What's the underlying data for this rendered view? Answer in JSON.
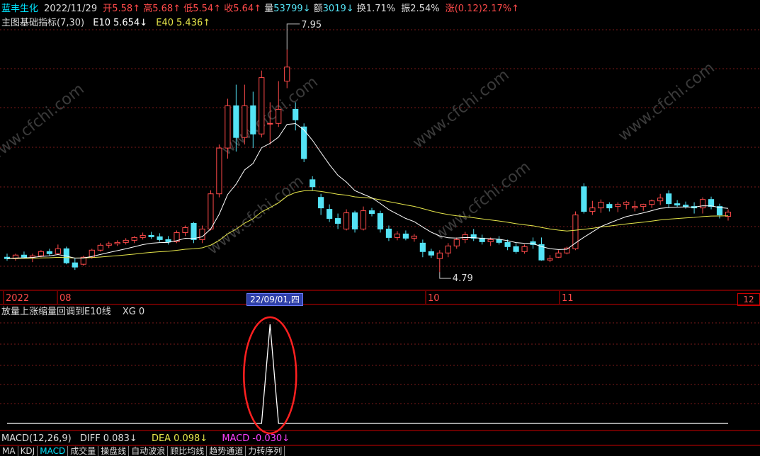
{
  "header": {
    "stock_name": "蓝丰生化",
    "date": "2022/11/29",
    "open_label": "开",
    "open_value": "5.58↑",
    "high_label": "高",
    "high_value": "5.68↑",
    "low_label": "低",
    "low_value": "5.54↑",
    "close_label": "收",
    "close_value": "5.64↑",
    "volume_label": "量",
    "volume_value": "53799↓",
    "amount_label": "额",
    "amount_value": "3019↓",
    "turnover_label": "换",
    "turnover_value": "1.71%",
    "amplitude_label": "振",
    "amplitude_value": "2.54%",
    "change_label": "涨",
    "change_value": "(0.12)2.17%↑"
  },
  "indicator": {
    "name": "主图基础指标(7,30)",
    "e10_label": "E10",
    "e10_value": "5.654↓",
    "e40_label": "E40",
    "e40_value": "5.436↑"
  },
  "annotations": {
    "high_mark": "7.95",
    "low_mark": "4.79"
  },
  "x_axis": {
    "labels": [
      "2022",
      "08",
      "10",
      "11"
    ],
    "cursor_date": "22/09/01,四",
    "right_label": "12"
  },
  "xg_panel": {
    "title": "放量上涨缩量回调到E10线",
    "xg_label": "XG",
    "xg_value": "0"
  },
  "macd_panel": {
    "name": "MACD(12,26,9)",
    "diff_label": "DIFF",
    "diff_value": "0.083↓",
    "dea_label": "DEA",
    "dea_value": "0.098↓",
    "macd_label": "MACD",
    "macd_value": "-0.030↓"
  },
  "tabs": [
    "MA",
    "KDJ",
    "MACD",
    "成交量",
    "操盘线",
    "自动波浪",
    "顾比均线",
    "趋势通道",
    "力转序列"
  ],
  "active_tab": "MACD",
  "watermark": "www.cfchi.com",
  "colors": {
    "up": "#ff4a4a",
    "down": "#54e3f5",
    "e10": "#ffffff",
    "e40": "#e6e64a",
    "grid": "#7a1a1a",
    "highlight_circle": "#ff2020"
  },
  "chart_data": {
    "type": "candlestick",
    "candles": [
      [
        5.0,
        5.05,
        4.95,
        4.98
      ],
      [
        4.98,
        5.05,
        4.95,
        5.03
      ],
      [
        5.03,
        5.08,
        4.98,
        5.0
      ],
      [
        5.0,
        5.05,
        4.93,
        5.02
      ],
      [
        5.02,
        5.1,
        5.0,
        5.08
      ],
      [
        5.08,
        5.12,
        5.02,
        5.05
      ],
      [
        5.05,
        5.18,
        5.03,
        5.12
      ],
      [
        5.12,
        5.15,
        4.9,
        4.92
      ],
      [
        4.92,
        4.98,
        4.82,
        4.86
      ],
      [
        4.9,
        5.02,
        4.88,
        5.0
      ],
      [
        5.0,
        5.12,
        4.98,
        5.1
      ],
      [
        5.1,
        5.2,
        5.08,
        5.17
      ],
      [
        5.17,
        5.22,
        5.13,
        5.19
      ],
      [
        5.19,
        5.24,
        5.16,
        5.21
      ],
      [
        5.21,
        5.27,
        5.18,
        5.24
      ],
      [
        5.24,
        5.3,
        5.2,
        5.28
      ],
      [
        5.28,
        5.35,
        5.25,
        5.31
      ],
      [
        5.31,
        5.36,
        5.26,
        5.29
      ],
      [
        5.29,
        5.34,
        5.22,
        5.25
      ],
      [
        5.25,
        5.3,
        5.18,
        5.22
      ],
      [
        5.22,
        5.38,
        5.2,
        5.35
      ],
      [
        5.35,
        5.45,
        5.3,
        5.42
      ],
      [
        5.48,
        5.5,
        5.2,
        5.25
      ],
      [
        5.25,
        5.45,
        5.2,
        5.4
      ],
      [
        5.4,
        5.95,
        5.38,
        5.9
      ],
      [
        5.9,
        6.6,
        5.85,
        6.55
      ],
      [
        6.55,
        7.25,
        6.4,
        7.15
      ],
      [
        7.15,
        7.45,
        6.5,
        6.7
      ],
      [
        6.7,
        7.45,
        6.6,
        7.15
      ],
      [
        7.15,
        7.35,
        6.55,
        6.75
      ],
      [
        6.75,
        7.65,
        6.7,
        7.55
      ],
      [
        6.9,
        7.2,
        6.6,
        6.9
      ],
      [
        6.9,
        7.5,
        6.85,
        7.1
      ],
      [
        7.5,
        7.95,
        7.4,
        7.7
      ],
      [
        7.1,
        7.2,
        6.8,
        6.95
      ],
      [
        6.85,
        6.9,
        6.35,
        6.4
      ],
      [
        6.1,
        6.15,
        5.95,
        6.0
      ],
      [
        5.85,
        5.9,
        5.6,
        5.7
      ],
      [
        5.68,
        5.75,
        5.5,
        5.55
      ],
      [
        5.55,
        5.62,
        5.4,
        5.48
      ],
      [
        5.4,
        5.68,
        5.38,
        5.63
      ],
      [
        5.63,
        5.66,
        5.35,
        5.4
      ],
      [
        5.4,
        5.72,
        5.38,
        5.66
      ],
      [
        5.66,
        5.7,
        5.58,
        5.62
      ],
      [
        5.62,
        5.66,
        5.35,
        5.4
      ],
      [
        5.4,
        5.45,
        5.23,
        5.28
      ],
      [
        5.28,
        5.37,
        5.24,
        5.33
      ],
      [
        5.33,
        5.38,
        5.24,
        5.27
      ],
      [
        5.27,
        5.33,
        5.22,
        5.3
      ],
      [
        5.2,
        5.25,
        5.0,
        5.08
      ],
      [
        5.08,
        5.12,
        4.99,
        5.03
      ],
      [
        4.98,
        5.1,
        4.79,
        5.06
      ],
      [
        5.06,
        5.2,
        5.0,
        5.16
      ],
      [
        5.16,
        5.28,
        5.12,
        5.25
      ],
      [
        5.25,
        5.36,
        5.2,
        5.32
      ],
      [
        5.32,
        5.4,
        5.23,
        5.27
      ],
      [
        5.27,
        5.32,
        5.18,
        5.22
      ],
      [
        5.22,
        5.28,
        5.16,
        5.25
      ],
      [
        5.25,
        5.3,
        5.18,
        5.21
      ],
      [
        5.21,
        5.25,
        5.1,
        5.15
      ],
      [
        5.15,
        5.2,
        5.05,
        5.08
      ],
      [
        5.08,
        5.18,
        5.05,
        5.15
      ],
      [
        5.22,
        5.28,
        5.12,
        5.18
      ],
      [
        5.18,
        5.28,
        4.95,
        4.96
      ],
      [
        4.96,
        5.03,
        4.93,
        4.98
      ],
      [
        5.0,
        5.1,
        4.99,
        5.06
      ],
      [
        5.06,
        5.15,
        5.04,
        5.13
      ],
      [
        5.12,
        5.65,
        5.1,
        5.6
      ],
      [
        6.0,
        6.05,
        5.62,
        5.65
      ],
      [
        5.65,
        5.8,
        5.6,
        5.7
      ],
      [
        5.7,
        5.82,
        5.63,
        5.78
      ],
      [
        5.75,
        5.78,
        5.65,
        5.7
      ],
      [
        5.72,
        5.78,
        5.64,
        5.75
      ],
      [
        5.75,
        5.8,
        5.68,
        5.78
      ],
      [
        5.7,
        5.8,
        5.65,
        5.72
      ],
      [
        5.72,
        5.76,
        5.66,
        5.75
      ],
      [
        5.75,
        5.82,
        5.7,
        5.8
      ],
      [
        5.8,
        5.9,
        5.74,
        5.84
      ],
      [
        5.9,
        5.95,
        5.7,
        5.76
      ],
      [
        5.76,
        5.81,
        5.71,
        5.74
      ],
      [
        5.74,
        5.79,
        5.69,
        5.72
      ],
      [
        5.72,
        5.78,
        5.62,
        5.7
      ],
      [
        5.7,
        5.85,
        5.62,
        5.82
      ],
      [
        5.82,
        5.86,
        5.68,
        5.72
      ],
      [
        5.72,
        5.76,
        5.55,
        5.6
      ],
      [
        5.58,
        5.68,
        5.52,
        5.64
      ]
    ],
    "xg_signal": [
      0,
      0,
      0,
      0,
      0,
      0,
      0,
      0,
      0,
      0,
      0,
      0,
      0,
      0,
      0,
      0,
      0,
      0,
      0,
      0,
      0,
      0,
      0,
      0,
      0,
      0,
      0,
      0,
      0,
      0,
      0,
      1,
      0,
      0,
      0,
      0,
      0,
      0,
      0,
      0,
      0,
      0,
      0,
      0,
      0,
      0,
      0,
      0,
      0,
      0,
      0,
      0,
      0,
      0,
      0,
      0,
      0,
      0,
      0,
      0,
      0,
      0,
      0,
      0,
      0,
      0,
      0,
      0,
      0,
      0,
      0,
      0,
      0,
      0,
      0,
      0,
      0,
      0,
      0,
      0,
      0,
      0,
      0,
      0,
      0,
      0
    ],
    "high_marker_index": 33,
    "low_marker_index": 51,
    "signal_index": 31
  }
}
